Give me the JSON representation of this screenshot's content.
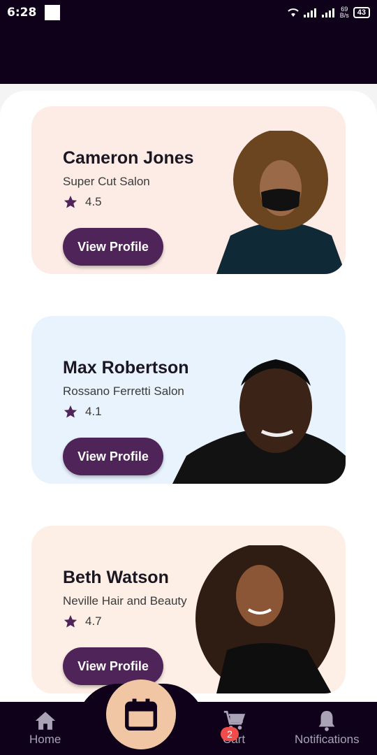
{
  "status_bar": {
    "time": "6:28",
    "speed_value": "69",
    "speed_unit": "B/s",
    "battery": "43"
  },
  "stylists": [
    {
      "name": "Cameron Jones",
      "salon": "Super Cut Salon",
      "rating": "4.5",
      "button": "View Profile",
      "card_color": "#fdece6"
    },
    {
      "name": "Max Robertson",
      "salon": "Rossano Ferretti Salon",
      "rating": "4.1",
      "button": "View Profile",
      "card_color": "#e9f3fe"
    },
    {
      "name": "Beth Watson",
      "salon": "Neville Hair and Beauty",
      "rating": "4.7",
      "button": "View Profile",
      "card_color": "#fdefe6"
    }
  ],
  "bottom_nav": {
    "home_label": "Home",
    "cart_label": "Cart",
    "cart_badge": "2",
    "notifications_label": "Notifications"
  },
  "colors": {
    "accent": "#4f2559",
    "nav_bg": "#0e0119",
    "fab": "#f1c6a4",
    "badge": "#f14c4c"
  },
  "icons": [
    "wifi-icon",
    "signal-icon",
    "star-icon",
    "home-icon",
    "calendar-icon",
    "cart-icon",
    "bell-icon"
  ]
}
